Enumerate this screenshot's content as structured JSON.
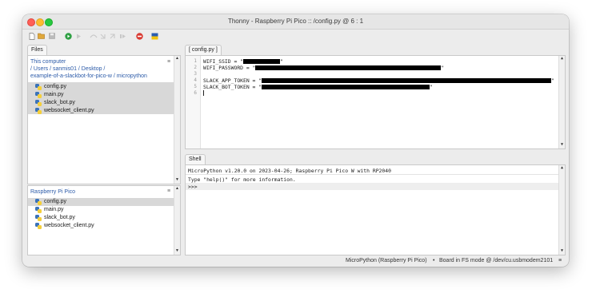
{
  "window": {
    "title": "Thonny  -  Raspberry Pi Pico :: /config.py  @  6 : 1"
  },
  "toolbar": {
    "icons": [
      "new-file-icon",
      "open-file-icon",
      "save-icon",
      "run-icon",
      "debug-icon",
      "step-over-icon",
      "step-into-icon",
      "step-out-icon",
      "resume-icon",
      "stop-icon",
      "switch-icon"
    ]
  },
  "files_panel": {
    "tab_label": "Files",
    "this_computer": {
      "header": "This computer",
      "path_line1": "/ Users / sanmis01 / Desktop /",
      "path_line2": "example-of-a-slackbot-for-pico-w / micropython",
      "files": [
        "config.py",
        "main.py",
        "slack_bot.py",
        "websocket_client.py"
      ]
    },
    "pico": {
      "header": "Raspberry Pi Pico",
      "files": [
        "config.py",
        "main.py",
        "slack_bot.py",
        "websocket_client.py"
      ]
    }
  },
  "editor": {
    "tab_label": "[ config.py ]",
    "lines": [
      {
        "num": "1",
        "prefix": "WIFI_SSID = \"",
        "suffix": "\""
      },
      {
        "num": "2",
        "prefix": "WIFI_PASSWORD = \"",
        "suffix": "\""
      },
      {
        "num": "3",
        "prefix": "",
        "suffix": ""
      },
      {
        "num": "4",
        "prefix": "SLACK_APP_TOKEN = \"",
        "suffix": "\""
      },
      {
        "num": "5",
        "prefix": "SLACK_BOT_TOKEN = \"",
        "suffix": "\""
      },
      {
        "num": "6",
        "prefix": "",
        "suffix": ""
      }
    ]
  },
  "shell": {
    "tab_label": "Shell",
    "line1": "MicroPython v1.20.0 on 2023-04-26; Raspberry Pi Pico W with RP2040",
    "line2": "Type \"help()\" for more information.",
    "prompt": ">>>"
  },
  "status": {
    "interpreter": "MicroPython (Raspberry Pi Pico)",
    "separator": "•",
    "board": "Board in FS mode @ /dev/cu.usbmodem2101",
    "menu": "≡"
  },
  "colors": {
    "selection": "#d8d8d8",
    "python_blue": "#3b73b9",
    "python_yellow": "#f5cf3a"
  }
}
